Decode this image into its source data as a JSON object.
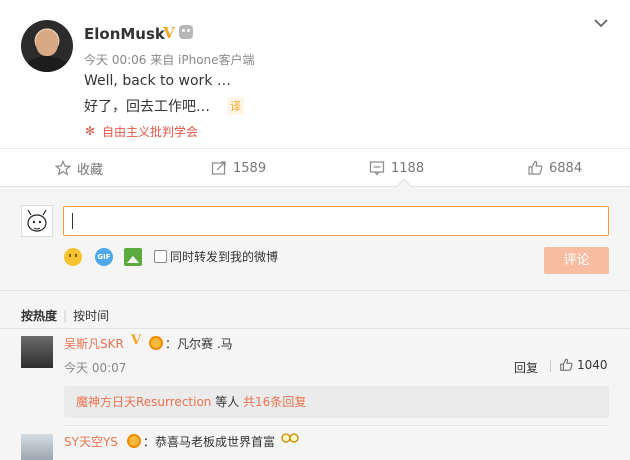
{
  "post": {
    "username": "ElonMusk",
    "verified_badge": "V",
    "meta": "今天 00:06 来自 iPhone客户端",
    "text_en": "Well, back to work …",
    "text_zh": "好了，回去工作吧…",
    "translate_tag": "译",
    "topic": "自由主义批判学会",
    "topic_icon": "✻",
    "chevron": "⌄"
  },
  "actions": {
    "favorite_label": "收藏",
    "repost_count": "1589",
    "comment_count": "1188",
    "like_count": "6884"
  },
  "comment_form": {
    "input_value": "",
    "gif_label": "GIF",
    "forward_label": "同时转发到我的微博",
    "submit_label": "评论"
  },
  "sort": {
    "hot": "按热度",
    "time": "按时间"
  },
  "comments": [
    {
      "user": "吴斯凡SKR",
      "verified_badge": "V",
      "text": "：凡尔赛 .马",
      "time": "今天 00:07",
      "reply_label": "回复",
      "likes": "1040",
      "sub_reply": {
        "user": "魔神方日天Resurrection",
        "mid": " 等人 ",
        "count": "共16条回复"
      }
    },
    {
      "user": "SY天空YS",
      "text": "：恭喜马老板成世界首富"
    }
  ],
  "colors": {
    "accent_orange": "#eb7350",
    "badge_gold": "#f5a623",
    "submit_disabled": "#f8bca0",
    "input_border": "#f29c3e"
  }
}
